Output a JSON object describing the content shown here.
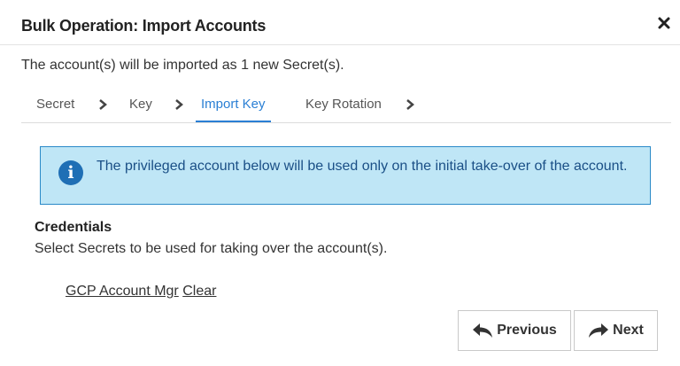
{
  "dialog": {
    "title": "Bulk Operation: Import Accounts",
    "close_icon": "close-icon"
  },
  "subtitle": "The account(s) will be imported as 1 new Secret(s).",
  "tabs": [
    {
      "label": "Secret",
      "active": false
    },
    {
      "label": "Key",
      "active": false
    },
    {
      "label": "Import Key",
      "active": true
    },
    {
      "label": "Key Rotation",
      "active": false
    }
  ],
  "info": {
    "icon": "info-icon",
    "text": "The privileged account below will be used only on the initial take-over of the account."
  },
  "credentials": {
    "title": "Credentials",
    "description": "Select Secrets to be used for taking over the account(s).",
    "secret_link": "GCP Account Mgr",
    "clear_link": "Clear"
  },
  "buttons": {
    "previous": "Previous",
    "next": "Next"
  },
  "colors": {
    "accent": "#2a7fd4",
    "info_bg": "#bfe6f6",
    "info_border": "#2a8ac8",
    "info_icon": "#1f6fb5"
  }
}
